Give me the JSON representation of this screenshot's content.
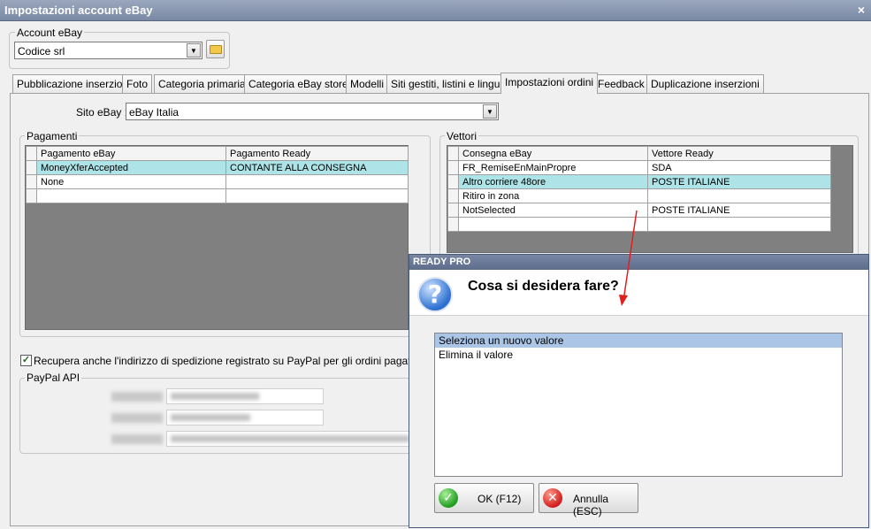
{
  "window": {
    "title": "Impostazioni account eBay",
    "close": "×"
  },
  "account": {
    "group_label": "Account eBay",
    "value": "Codice srl"
  },
  "tabs": [
    {
      "label": "Pubblicazione inserzioni"
    },
    {
      "label": "Foto"
    },
    {
      "label": "Categoria primaria"
    },
    {
      "label": "Categoria eBay store"
    },
    {
      "label": "Modelli"
    },
    {
      "label": "Siti gestiti, listini e lingue"
    },
    {
      "label": "Impostazioni ordini"
    },
    {
      "label": "Feedback"
    },
    {
      "label": "Duplicazione inserzioni"
    }
  ],
  "site": {
    "label": "Sito eBay :",
    "value": "eBay Italia"
  },
  "payments": {
    "group_label": "Pagamenti",
    "headers": [
      "Pagamento eBay",
      "Pagamento Ready"
    ],
    "rows": [
      [
        "MoneyXferAccepted",
        "CONTANTE ALLA CONSEGNA"
      ],
      [
        "None",
        ""
      ],
      [
        "",
        ""
      ]
    ]
  },
  "carriers": {
    "group_label": "Vettori",
    "headers": [
      "Consegna eBay",
      "Vettore Ready"
    ],
    "rows": [
      [
        "FR_RemiseEnMainPropre",
        "SDA"
      ],
      [
        "Altro corriere 48ore",
        "POSTE ITALIANE"
      ],
      [
        "Ritiro in zona",
        ""
      ],
      [
        "NotSelected",
        "POSTE ITALIANE"
      ],
      [
        "",
        ""
      ]
    ]
  },
  "paypal": {
    "checkbox_label": "Recupera anche l'indirizzo di spedizione registrato su PayPal per gli ordini pagati con PayP",
    "api_group_label": "PayPal API"
  },
  "dialog": {
    "title": "READY PRO",
    "question": "Cosa si desidera fare?",
    "options": [
      "Seleziona un nuovo valore",
      "Elimina il valore"
    ],
    "ok_label": "OK (F12)",
    "cancel_label": "Annulla (ESC)"
  },
  "colors": {
    "selected_row": "#aee4e8",
    "annotation_arrow": "#e02020",
    "titlebar": "#8795b0"
  }
}
